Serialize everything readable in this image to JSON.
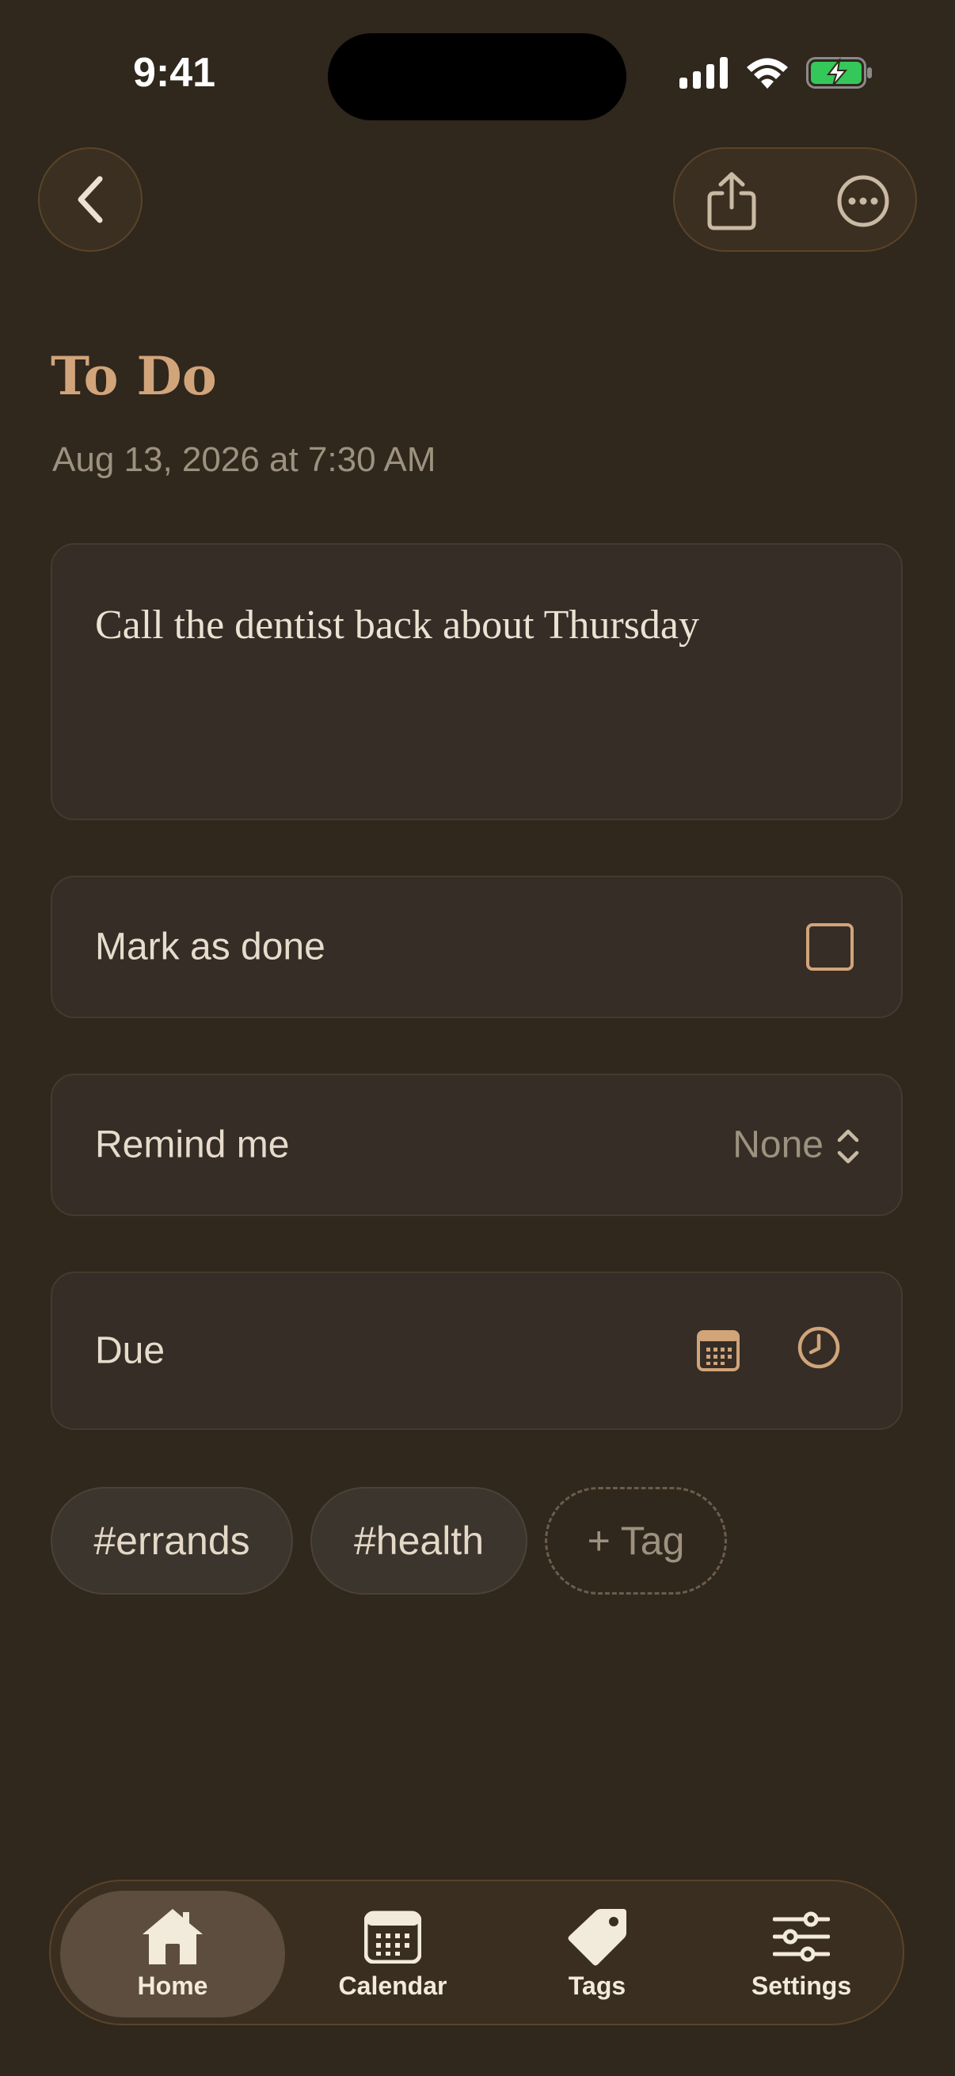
{
  "status_bar": {
    "time": "9:41"
  },
  "header": {
    "back_icon": "chevron-left-icon",
    "share_icon": "share-icon",
    "more_icon": "ellipsis-circle-icon"
  },
  "page": {
    "title": "To Do",
    "timestamp": "Aug 13, 2026 at 7:30 AM"
  },
  "note": {
    "text": "Call the dentist back about Thursday"
  },
  "mark_done": {
    "label": "Mark as done",
    "checked": false
  },
  "remind": {
    "label": "Remind me",
    "value": "None"
  },
  "due": {
    "label": "Due",
    "calendar_icon": "calendar-icon",
    "clock_icon": "clock-icon"
  },
  "tags": {
    "items": [
      {
        "label": "#errands"
      },
      {
        "label": "#health"
      }
    ],
    "add_label": "+ Tag"
  },
  "tabbar": {
    "items": [
      {
        "label": "Home",
        "icon": "house-icon",
        "active": true
      },
      {
        "label": "Calendar",
        "icon": "calendar-icon",
        "active": false
      },
      {
        "label": "Tags",
        "icon": "tag-icon",
        "active": false
      },
      {
        "label": "Settings",
        "icon": "sliders-icon",
        "active": false
      }
    ]
  },
  "colors": {
    "background": "#30271d",
    "accent": "#d1a47a",
    "card": "#352d26",
    "battery_green": "#34c759"
  }
}
